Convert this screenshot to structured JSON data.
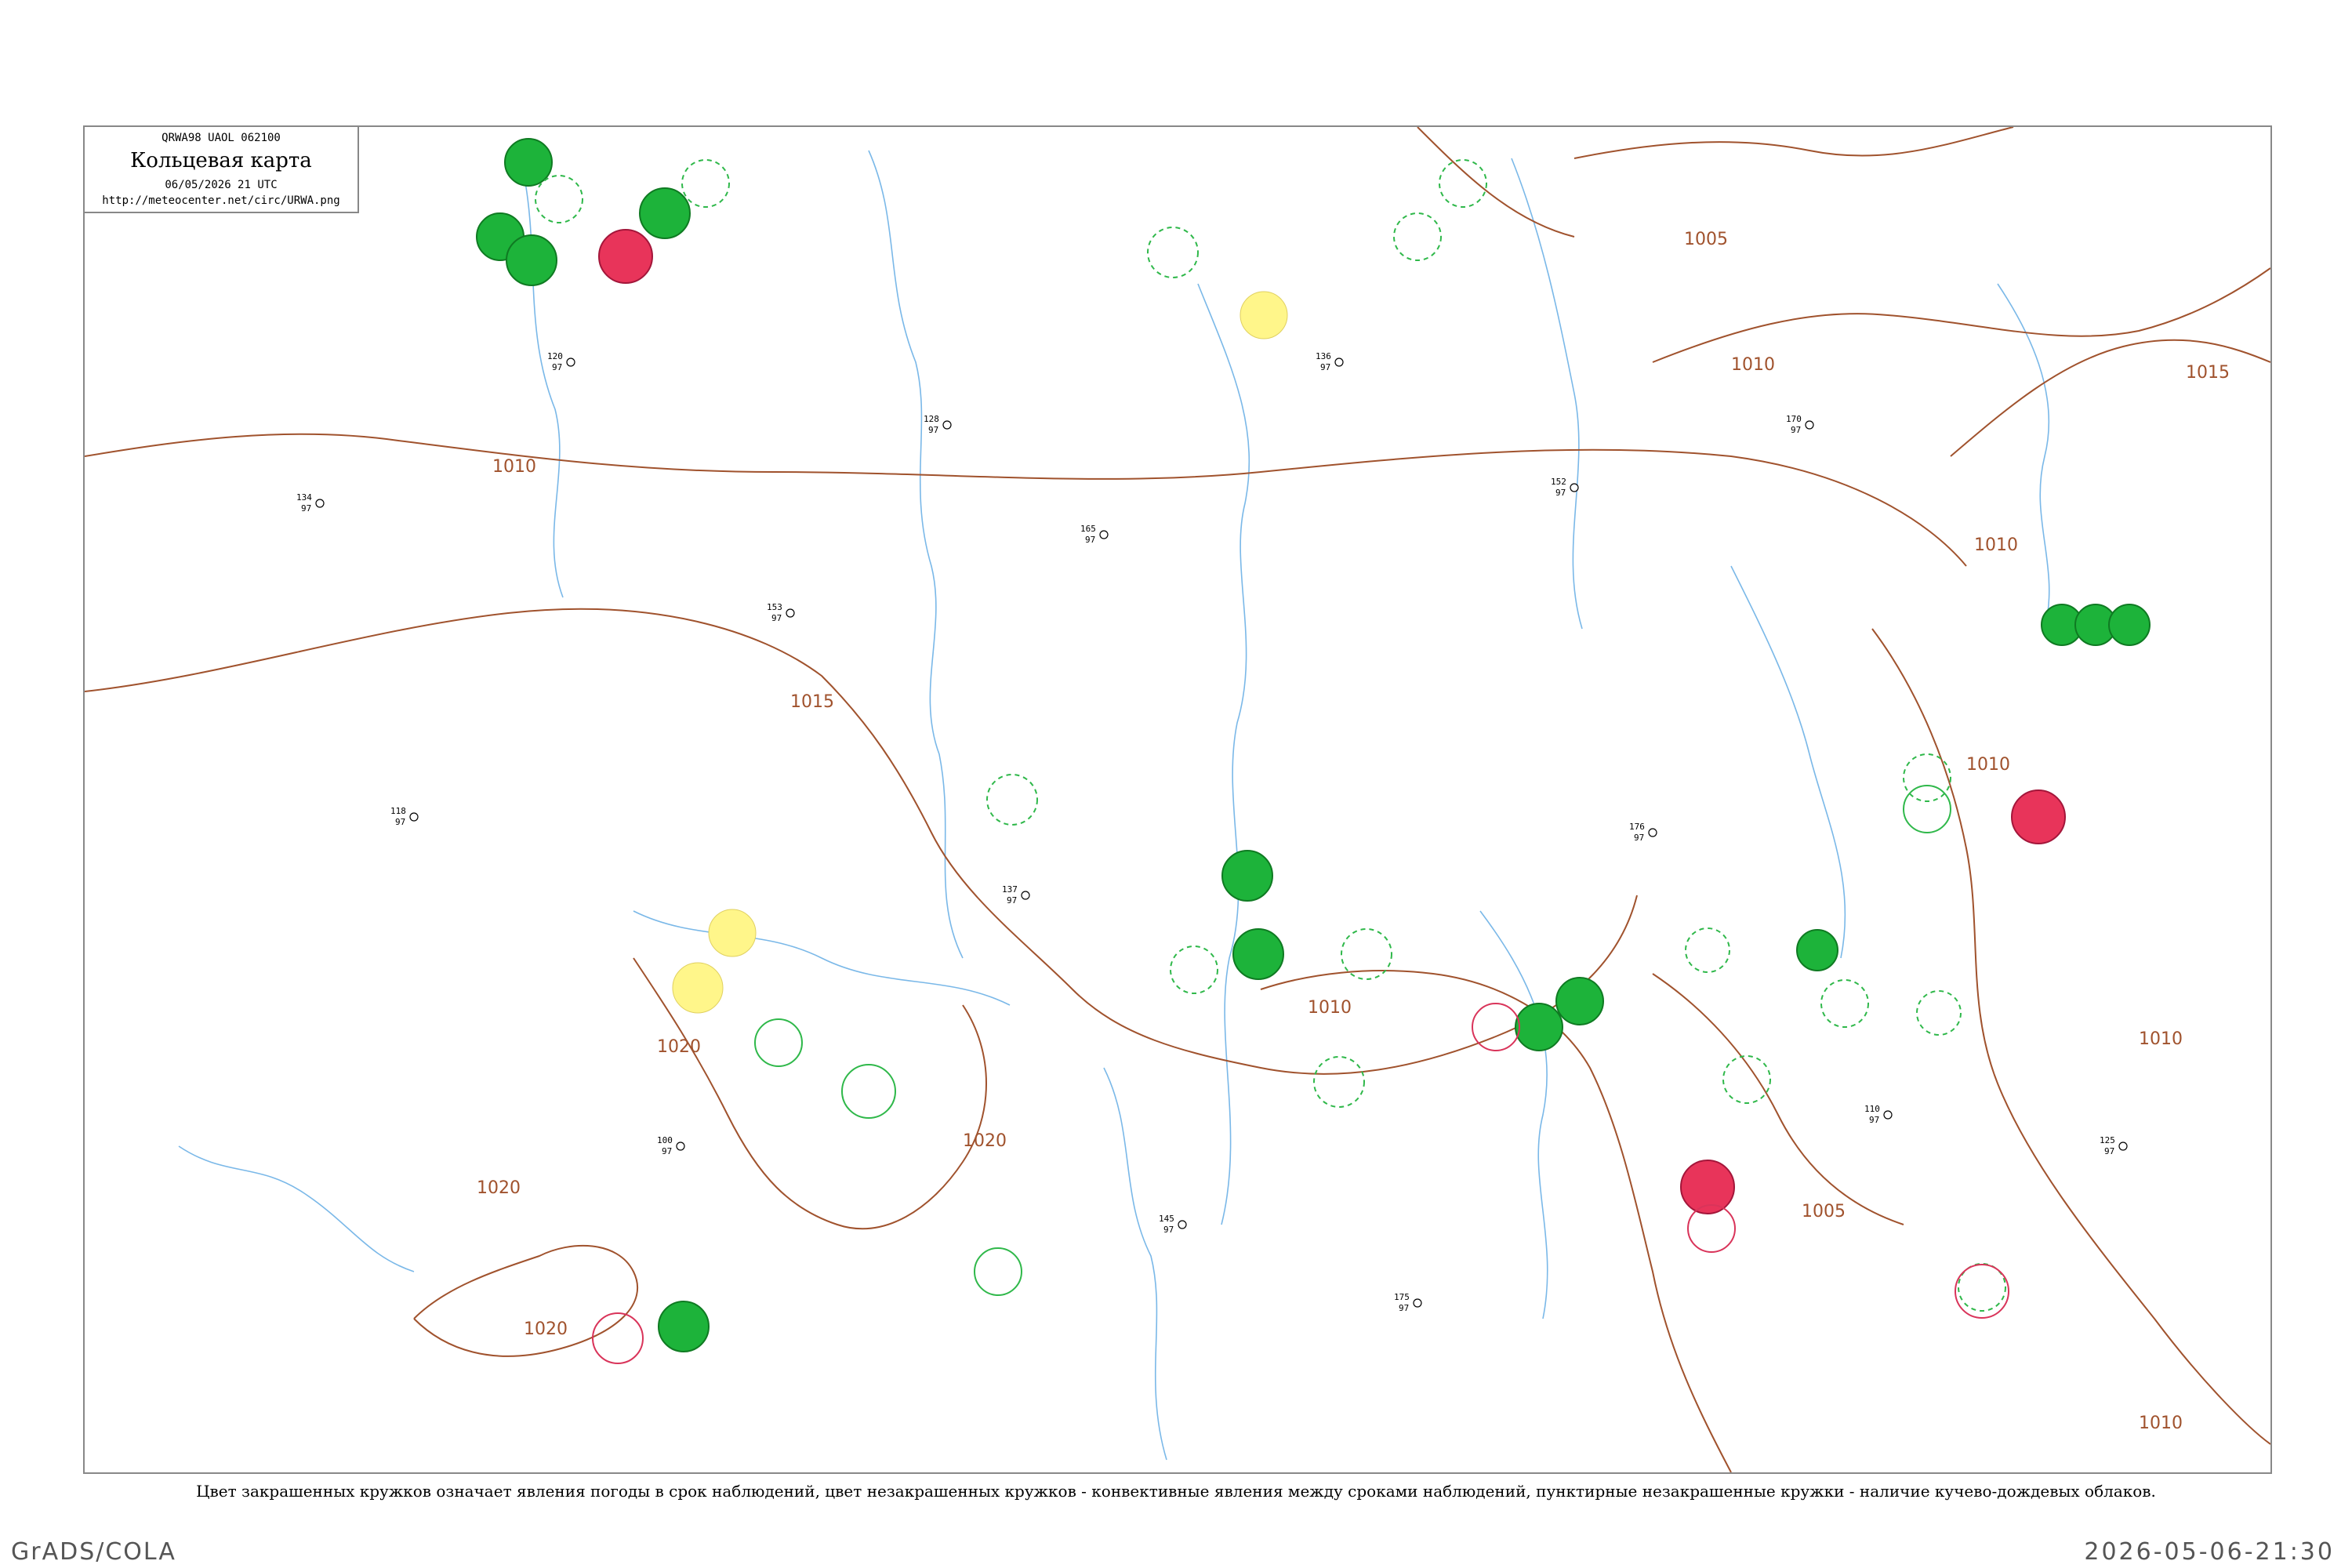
{
  "header": {
    "code_line": "QRWA98 UAOL 062100",
    "title": "Кольцевая карта",
    "datetime": "06/05/2026 21 UTC",
    "url": "http://meteocenter.net/circ/URWA.png"
  },
  "caption": "Цвет закрашенных кружков означает явления погоды в срок наблюдений, цвет незакрашенных кружков - конвективные явления между сроками наблюдений, пунктирные незакрашенные кружки - наличие кучево-дождевых облаков.",
  "footer": {
    "left": "GrADS/COLA",
    "right": "2026-05-06-21:30"
  },
  "colors": {
    "isobar": "#a0522d",
    "river": "#7ab8e8",
    "green_fill": "#1db33a",
    "green_ring": "#2fb84a",
    "red_fill": "#e8345a",
    "red_ring": "#d9345a",
    "yellow_fill": "#fff68a"
  },
  "isobars": [
    {
      "label": "1005"
    },
    {
      "label": "1010"
    },
    {
      "label": "1015"
    },
    {
      "label": "1020"
    }
  ],
  "stations": [
    {
      "id": "st1",
      "num": "134",
      "num2": "97"
    },
    {
      "id": "st2",
      "num": "120",
      "num2": "97"
    },
    {
      "id": "st3",
      "num": "153",
      "num2": "97"
    },
    {
      "id": "st4",
      "num": "128",
      "num2": "97"
    },
    {
      "id": "st5",
      "num": "165",
      "num2": "97"
    },
    {
      "id": "st6",
      "num": "136",
      "num2": "97"
    },
    {
      "id": "st7",
      "num": "152",
      "num2": "97"
    },
    {
      "id": "st8",
      "num": "170",
      "num2": "97"
    },
    {
      "id": "st9",
      "num": "118",
      "num2": "97"
    },
    {
      "id": "st10",
      "num": "100",
      "num2": "97"
    },
    {
      "id": "st11",
      "num": "137",
      "num2": "97"
    },
    {
      "id": "st12",
      "num": "145",
      "num2": "97"
    },
    {
      "id": "st13",
      "num": "175",
      "num2": "97"
    },
    {
      "id": "st14",
      "num": "176",
      "num2": "97"
    },
    {
      "id": "st15",
      "num": "110",
      "num2": "97"
    },
    {
      "id": "st16",
      "num": "125",
      "num2": "97"
    }
  ]
}
